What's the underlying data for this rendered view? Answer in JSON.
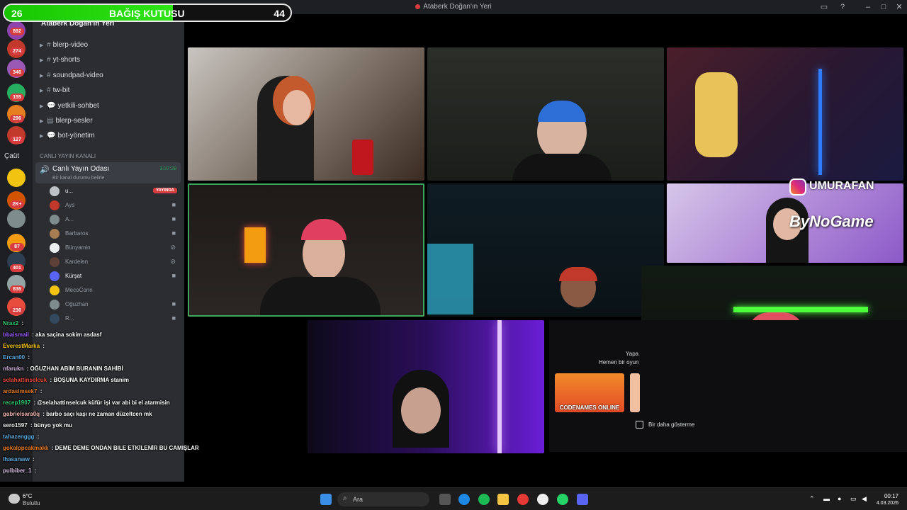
{
  "window": {
    "title": "Ataberk Doğan'ın Yeri"
  },
  "donation": {
    "left": "26",
    "label": "BAĞIŞ KUTUSU",
    "right": "44",
    "progress": 0.59
  },
  "servers": {
    "badges": [
      "892",
      "274",
      "346",
      "155",
      "296",
      "127",
      "2K+",
      "87",
      "401",
      "836",
      "236"
    ],
    "label": "Çaüt"
  },
  "sidebar": {
    "server_name": "Ataberk Doğan'ın Yeri",
    "channels": [
      "blerp-video",
      "yt-shorts",
      "soundpad-video",
      "tw-bit",
      "yetkili-sohbet",
      "blerp-sesler",
      "bot-yönetim"
    ],
    "category": "CANLI YAYIN KANALI",
    "live_room": {
      "name": "Canlı Yayın Odası",
      "subtitle": "Bir kanal durumu belirle",
      "time": "3:37:28"
    },
    "users": [
      {
        "name": "u...",
        "live": "YAYINDA"
      },
      {
        "name": "Ays"
      },
      {
        "name": "A..."
      },
      {
        "name": "Barbaros"
      },
      {
        "name": "Bünyamin"
      },
      {
        "name": "Kardelen"
      },
      {
        "name": "Kürşat"
      },
      {
        "name": "MecoConn"
      },
      {
        "name": "Oğuzhan"
      },
      {
        "name": "R..."
      }
    ]
  },
  "chat": [
    {
      "user": "Nrax2",
      "text": "",
      "color": "#2ecc71"
    },
    {
      "user": "bbaismail",
      "text": "aka saçina sokim asdasf",
      "color": "#9b59ff"
    },
    {
      "user": "EverestMarka",
      "text": "",
      "color": "#f1c40f"
    },
    {
      "user": "Ercan00",
      "text": "",
      "color": "#5dade2"
    },
    {
      "user": "nfarukn",
      "text": "OĞUZHAN ABİM BURANIN SAHİBİ",
      "color": "#d2b4de"
    },
    {
      "user": "selahattinselcuk",
      "text": "BOŞUNA KAYDIRMA stanim",
      "color": "#e74c3c"
    },
    {
      "user": "ardasimsek7",
      "text": "",
      "color": "#e67e22"
    },
    {
      "user": "recep1907",
      "text": "@selahattinselcuk küfür işi var abi bi el atarmisin",
      "color": "#2ecc71"
    },
    {
      "user": "gabrielsara0q",
      "text": "barbo saçı kaşı ne zaman düzeltcen mk",
      "color": "#f5b7b1"
    },
    {
      "user": "sero1597",
      "text": "bünyo yok mu",
      "color": "#ecf0f1"
    },
    {
      "user": "tahazenggg",
      "text": "",
      "color": "#5dade2"
    },
    {
      "user": "gokalppcakmakk",
      "text": "DEME DEME ONDAN BILE ETKİLENİR BU CAMIŞLAR",
      "color": "#e67e22"
    },
    {
      "user": "lhasanww",
      "text": "",
      "color": "#5dade2"
    },
    {
      "user": "pulbiber_1",
      "text": "",
      "color": "#d7bde2"
    }
  ],
  "overlay": {
    "instagram": "UMURAFAN",
    "sponsor": "ByNoGame"
  },
  "popup": {
    "line1": "Yapa",
    "line2": "Hemen bir oyun",
    "game_card": "CODENAMES ONLINE",
    "checkbox_label": "Bir daha gösterme"
  },
  "taskbar": {
    "temperature": "6°C",
    "condition": "Bulutlu",
    "search_placeholder": "Ara",
    "time": "00:17",
    "date": "4.03.2026"
  }
}
